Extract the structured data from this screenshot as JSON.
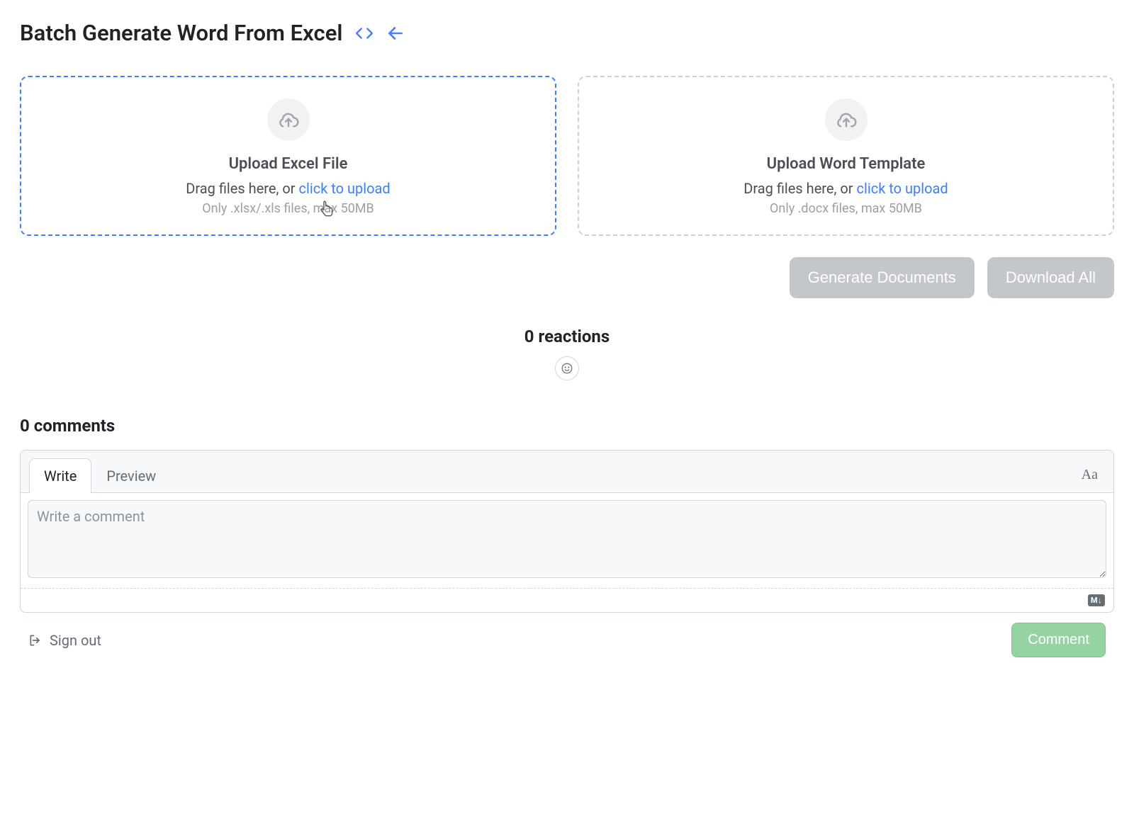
{
  "header": {
    "title": "Batch Generate Word From Excel"
  },
  "upload": {
    "excel": {
      "title": "Upload Excel File",
      "drag_prefix": "Drag files here, or ",
      "link": "click to upload",
      "hint": "Only .xlsx/.xls files, max 50MB"
    },
    "word": {
      "title": "Upload Word Template",
      "drag_prefix": "Drag files here, or ",
      "link": "click to upload",
      "hint": "Only .docx files, max 50MB"
    }
  },
  "actions": {
    "generate": "Generate Documents",
    "download": "Download All"
  },
  "reactions": {
    "title": "0 reactions"
  },
  "comments": {
    "heading": "0 comments",
    "tab_write": "Write",
    "tab_preview": "Preview",
    "placeholder": "Write a comment",
    "markdown_badge": "M↓",
    "signout": "Sign out",
    "submit": "Comment",
    "text_style": "Aa"
  }
}
